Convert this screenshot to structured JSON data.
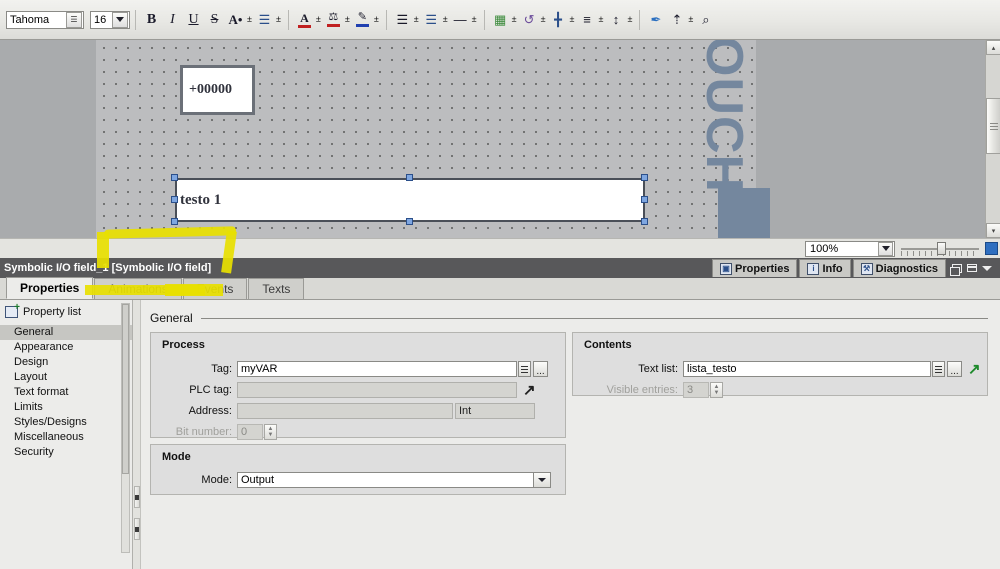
{
  "toolbar": {
    "font_family_value": "Tahoma",
    "font_size_value": "16",
    "buttons": [
      {
        "name": "bold",
        "label": "B"
      },
      {
        "name": "italic",
        "label": "I"
      },
      {
        "name": "underline",
        "label": "U"
      },
      {
        "name": "strikethrough",
        "label": "S"
      },
      {
        "name": "font-size-grow",
        "label": "A"
      },
      {
        "name": "line-spacing",
        "label": "≡"
      },
      {
        "name": "font-color",
        "label": "A"
      },
      {
        "name": "fill-color",
        "label": "◢"
      },
      {
        "name": "pen-color",
        "label": "╱"
      },
      {
        "name": "align-text",
        "label": "≡"
      },
      {
        "name": "align-block",
        "label": "≡"
      },
      {
        "name": "line-style",
        "label": "—"
      },
      {
        "name": "order-front",
        "label": "◧"
      },
      {
        "name": "rotate",
        "label": "↻"
      },
      {
        "name": "align-horizontal",
        "label": "⬌"
      },
      {
        "name": "distribute-vertical",
        "label": "≣"
      },
      {
        "name": "distribute-height",
        "label": "↕"
      },
      {
        "name": "format-painter",
        "label": "✒"
      },
      {
        "name": "apply-style",
        "label": "↑"
      },
      {
        "name": "zoom-select",
        "label": "⌕"
      }
    ]
  },
  "canvas": {
    "io_field_value": "+00000",
    "text_field_value": "testo 1",
    "watermark": "OUCH",
    "zoom_value": "100%"
  },
  "panel": {
    "title": "Symbolic I/O field_1 [Symbolic I/O field]",
    "right_tabs": [
      {
        "label": "Properties",
        "icon": "properties-icon"
      },
      {
        "label": "Info",
        "icon": "info-icon"
      },
      {
        "label": "Diagnostics",
        "icon": "diagnostics-icon"
      }
    ]
  },
  "tabs": [
    {
      "label": "Properties",
      "active": true
    },
    {
      "label": "Animations",
      "active": false
    },
    {
      "label": "Events",
      "active": false
    },
    {
      "label": "Texts",
      "active": false
    }
  ],
  "property_list": {
    "header": "Property list",
    "items": [
      {
        "label": "General",
        "selected": true
      },
      {
        "label": "Appearance",
        "selected": false
      },
      {
        "label": "Design",
        "selected": false
      },
      {
        "label": "Layout",
        "selected": false
      },
      {
        "label": "Text format",
        "selected": false
      },
      {
        "label": "Limits",
        "selected": false
      },
      {
        "label": "Styles/Designs",
        "selected": false
      },
      {
        "label": "Miscellaneous",
        "selected": false
      },
      {
        "label": "Security",
        "selected": false
      }
    ]
  },
  "general": {
    "section_title": "General",
    "process": {
      "title": "Process",
      "tag_label": "Tag:",
      "tag_value": "myVAR",
      "plc_tag_label": "PLC tag:",
      "plc_tag_value": "",
      "address_label": "Address:",
      "address_value": "",
      "address_type": "Int",
      "bit_number_label": "Bit number:",
      "bit_number_value": "0"
    },
    "contents": {
      "title": "Contents",
      "text_list_label": "Text list:",
      "text_list_value": "lista_testo",
      "visible_entries_label": "Visible entries:",
      "visible_entries_value": "3"
    },
    "mode": {
      "title": "Mode",
      "mode_label": "Mode:",
      "mode_value": "Output"
    }
  },
  "colors": {
    "title_bar": "#58585a",
    "highlight": "#e8e000",
    "accent_blue": "#74879e",
    "selection_handle": "#7ea6e0",
    "green_arrow": "#1d8a2b"
  }
}
